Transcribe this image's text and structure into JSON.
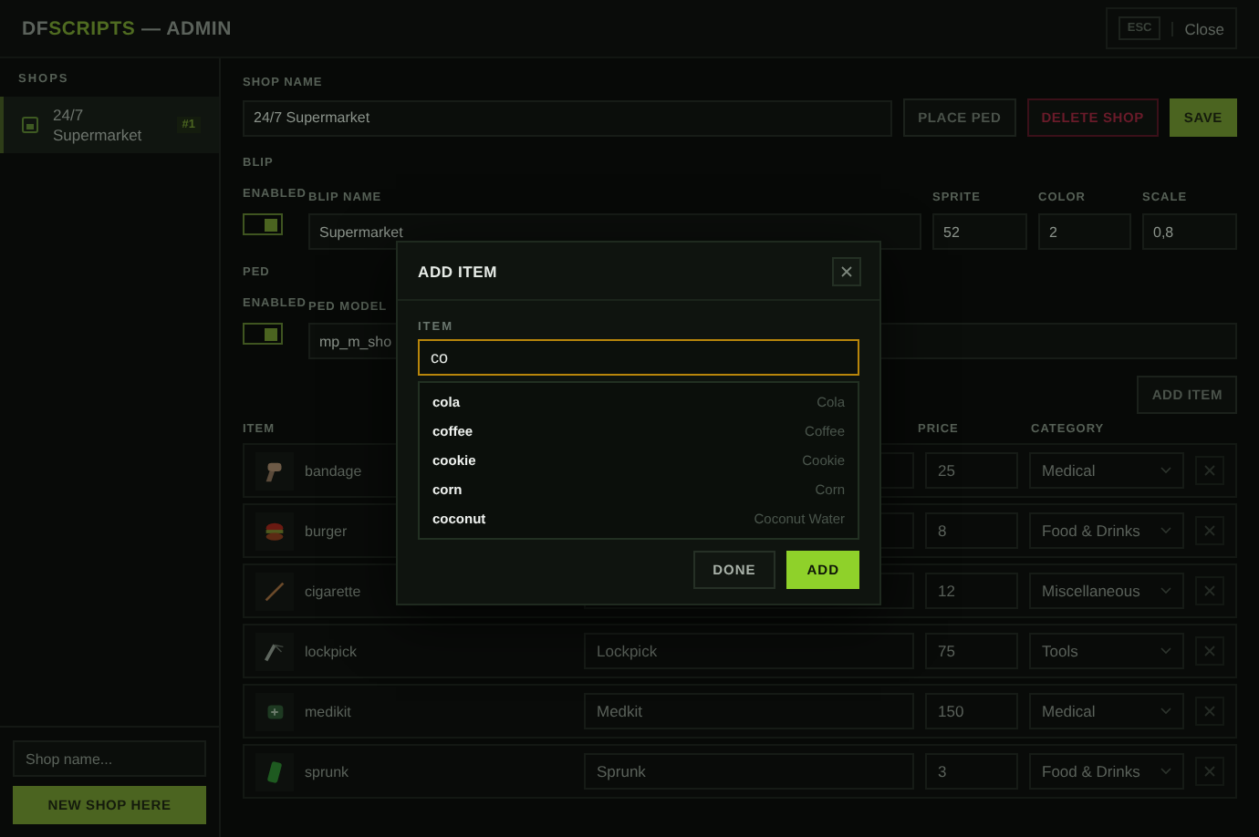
{
  "header": {
    "brand_prefix": "DF",
    "brand_highlight": "SCRIPTS",
    "brand_suffix": "— ADMIN",
    "shortcut": "ESC",
    "close": "Close"
  },
  "sidebar": {
    "heading": "SHOPS",
    "shops": [
      {
        "name": "24/7 Supermarket",
        "badge": "#1",
        "selected": true
      }
    ],
    "new_shop": {
      "placeholder": "Shop name...",
      "button": "NEW SHOP HERE"
    }
  },
  "shop": {
    "name_label": "SHOP NAME",
    "name": "24/7 Supermarket",
    "buttons": [
      {
        "label": "PLACE PED",
        "kind": "secondary"
      },
      {
        "label": "DELETE SHOP",
        "kind": "danger"
      },
      {
        "label": "SAVE",
        "kind": "primary"
      }
    ]
  },
  "blip": {
    "heading": "BLIP",
    "enabled_label": "ENABLED",
    "enabled": true,
    "fields": [
      {
        "label": "BLIP NAME",
        "value": "Supermarket"
      },
      {
        "label": "SPRITE",
        "value": "52"
      },
      {
        "label": "COLOR",
        "value": "2"
      },
      {
        "label": "SCALE",
        "value": "0,8"
      }
    ]
  },
  "ped": {
    "heading": "PED",
    "enabled_label": "ENABLED",
    "enabled": true,
    "model_label": "PED MODEL",
    "model": "mp_m_sho"
  },
  "items": {
    "add_button": "ADD ITEM",
    "columns": {
      "item": "ITEM",
      "price": "PRICE",
      "category": "CATEGORY"
    },
    "rows": [
      {
        "name": "bandage",
        "price": "25",
        "category": "Medical"
      },
      {
        "name": "burger",
        "price": "8",
        "category": "Food & Drinks"
      },
      {
        "name": "cigarette",
        "price": "12",
        "category": "Miscellaneous"
      },
      {
        "name": "lockpick",
        "label": "Lockpick",
        "price": "75",
        "category": "Tools"
      },
      {
        "name": "medikit",
        "label": "Medkit",
        "price": "150",
        "category": "Medical"
      },
      {
        "name": "sprunk",
        "label": "Sprunk",
        "price": "3",
        "category": "Food & Drinks"
      }
    ]
  },
  "modal": {
    "title": "ADD ITEM",
    "field_label": "ITEM",
    "value": "co",
    "suggestions": [
      {
        "name": "cola",
        "label": "Cola"
      },
      {
        "name": "coffee",
        "label": "Coffee"
      },
      {
        "name": "cookie",
        "label": "Cookie"
      },
      {
        "name": "corn",
        "label": "Corn"
      },
      {
        "name": "coconut",
        "label": "Coconut Water"
      }
    ],
    "buttons": [
      {
        "label": "DONE",
        "kind": "secondary"
      },
      {
        "label": "ADD",
        "kind": "primary"
      }
    ]
  }
}
